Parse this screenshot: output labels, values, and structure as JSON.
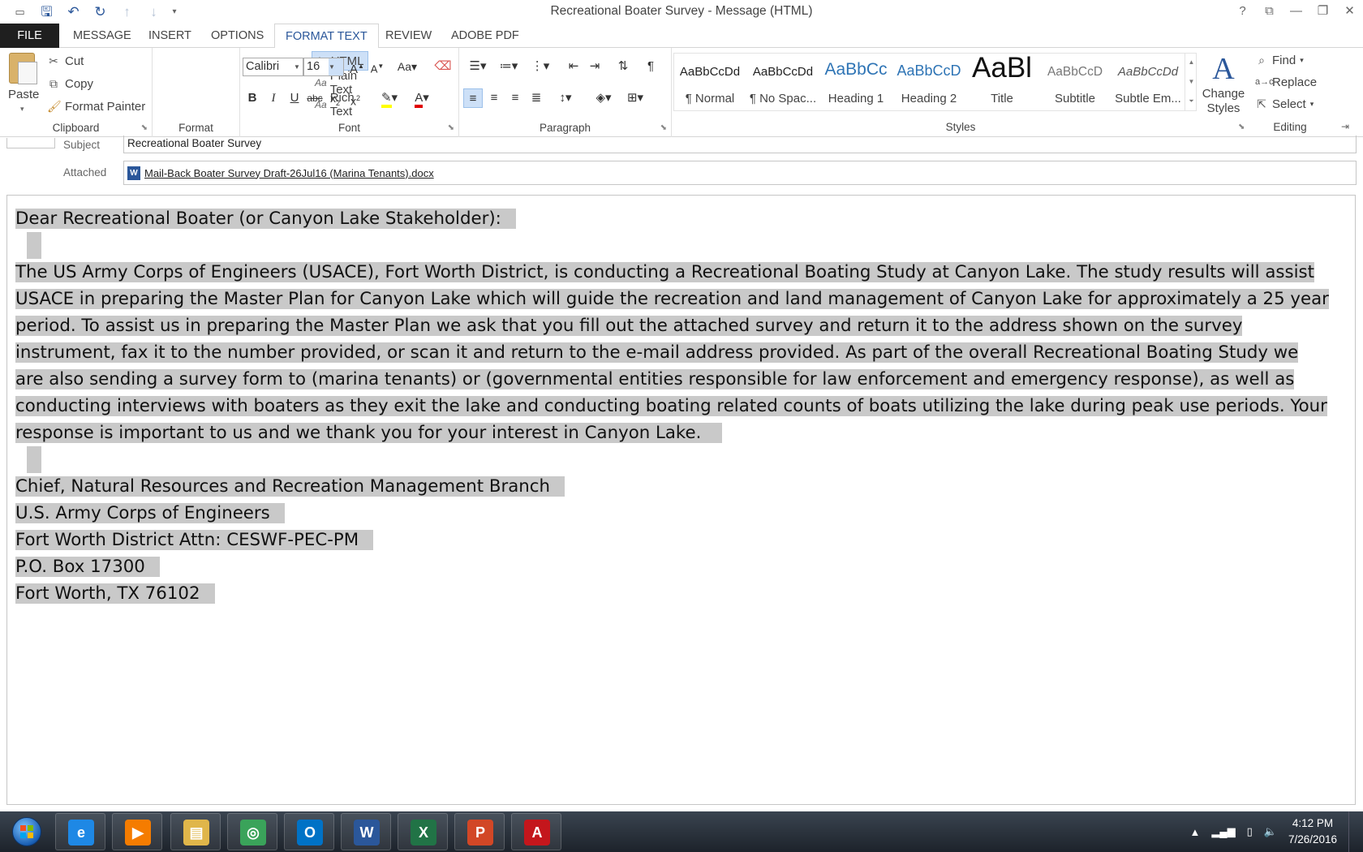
{
  "window": {
    "title": "Recreational Boater Survey - Message (HTML)",
    "controls": [
      "?",
      "⧉",
      "—",
      "❐",
      "✕"
    ]
  },
  "qat": [
    "save-icon",
    "undo-icon",
    "redo-icon",
    "up-icon",
    "down-icon",
    "customize-icon"
  ],
  "tabs": [
    {
      "label": "FILE"
    },
    {
      "label": "MESSAGE"
    },
    {
      "label": "INSERT"
    },
    {
      "label": "OPTIONS"
    },
    {
      "label": "FORMAT TEXT"
    },
    {
      "label": "REVIEW"
    },
    {
      "label": "ADOBE PDF"
    }
  ],
  "clipboard": {
    "label": "Clipboard",
    "paste": "Paste",
    "cut": "Cut",
    "copy": "Copy",
    "format_painter": "Format Painter"
  },
  "format": {
    "label": "Format",
    "html": "HTML",
    "plain": "Plain Text",
    "rich": "Rich Text",
    "aa": "Aa"
  },
  "font": {
    "label": "Font",
    "family": "Calibri",
    "size": "16"
  },
  "paragraph": {
    "label": "Paragraph"
  },
  "styles": {
    "label": "Styles",
    "items": [
      {
        "preview": "AaBbCcDd",
        "name": "¶ Normal"
      },
      {
        "preview": "AaBbCcDd",
        "name": "¶ No Spac..."
      },
      {
        "preview": "AaBbCc",
        "name": "Heading 1"
      },
      {
        "preview": "AaBbCcD",
        "name": "Heading 2"
      },
      {
        "preview": "AaBl",
        "name": "Title"
      },
      {
        "preview": "AaBbCcD",
        "name": "Subtitle"
      },
      {
        "preview": "AaBbCcDd",
        "name": "Subtle Em..."
      }
    ],
    "change_styles_1": "Change",
    "change_styles_2": "Styles",
    "change_icon": "A"
  },
  "editing": {
    "label": "Editing",
    "find": "Find",
    "replace": "Replace",
    "select": "Select"
  },
  "header": {
    "subject_label": "Subject",
    "subject_value": "Recreational Boater Survey",
    "attached_label": "Attached",
    "attachment": "Mail-Back Boater Survey Draft-26Jul16 (Marina Tenants).docx"
  },
  "body": {
    "greeting": "Dear Recreational Boater (or Canyon Lake Stakeholder):",
    "paragraph": "The US Army Corps of Engineers (USACE), Fort Worth District, is conducting a Recreational Boating Study at Canyon Lake. The study results will assist USACE in preparing the Master Plan for Canyon Lake which will guide the recreation and land management of Canyon Lake for approximately a 25 year period.  To assist us in preparing the Master Plan we ask that you fill out the attached survey and return it to the address shown on the survey instrument, fax it to the number provided, or scan it and return to the e-mail address provided.  As part of the overall Recreational Boating Study we are also sending a survey form to (marina tenants) or (governmental entities responsible for law enforcement and emergency response), as well as conducting interviews with boaters as they exit the lake and conducting boating related counts of boats utilizing the lake during peak use periods.  Your response is important to us and we thank you for your interest in Canyon Lake.",
    "address": [
      "Chief, Natural Resources and Recreation Management Branch",
      "U.S. Army Corps of Engineers",
      "Fort Worth District  Attn: CESWF-PEC-PM",
      "P.O. Box 17300",
      "Fort Worth, TX 76102"
    ]
  },
  "taskbar": {
    "apps": [
      {
        "name": "internet-explorer-icon",
        "glyph": "e",
        "color": "#1e88e5"
      },
      {
        "name": "media-player-icon",
        "glyph": "▶",
        "color": "#f57c00"
      },
      {
        "name": "file-explorer-icon",
        "glyph": "▤",
        "color": "#e0b64a"
      },
      {
        "name": "globe-app-icon",
        "glyph": "◎",
        "color": "#3aa35a"
      },
      {
        "name": "outlook-icon",
        "glyph": "O",
        "color": "#0072c6"
      },
      {
        "name": "word-icon",
        "glyph": "W",
        "color": "#2b579a"
      },
      {
        "name": "excel-icon",
        "glyph": "X",
        "color": "#217346"
      },
      {
        "name": "powerpoint-icon",
        "glyph": "P",
        "color": "#d24726"
      },
      {
        "name": "acrobat-icon",
        "glyph": "A",
        "color": "#c4161c"
      }
    ],
    "time": "4:12 PM",
    "date": "7/26/2016"
  }
}
